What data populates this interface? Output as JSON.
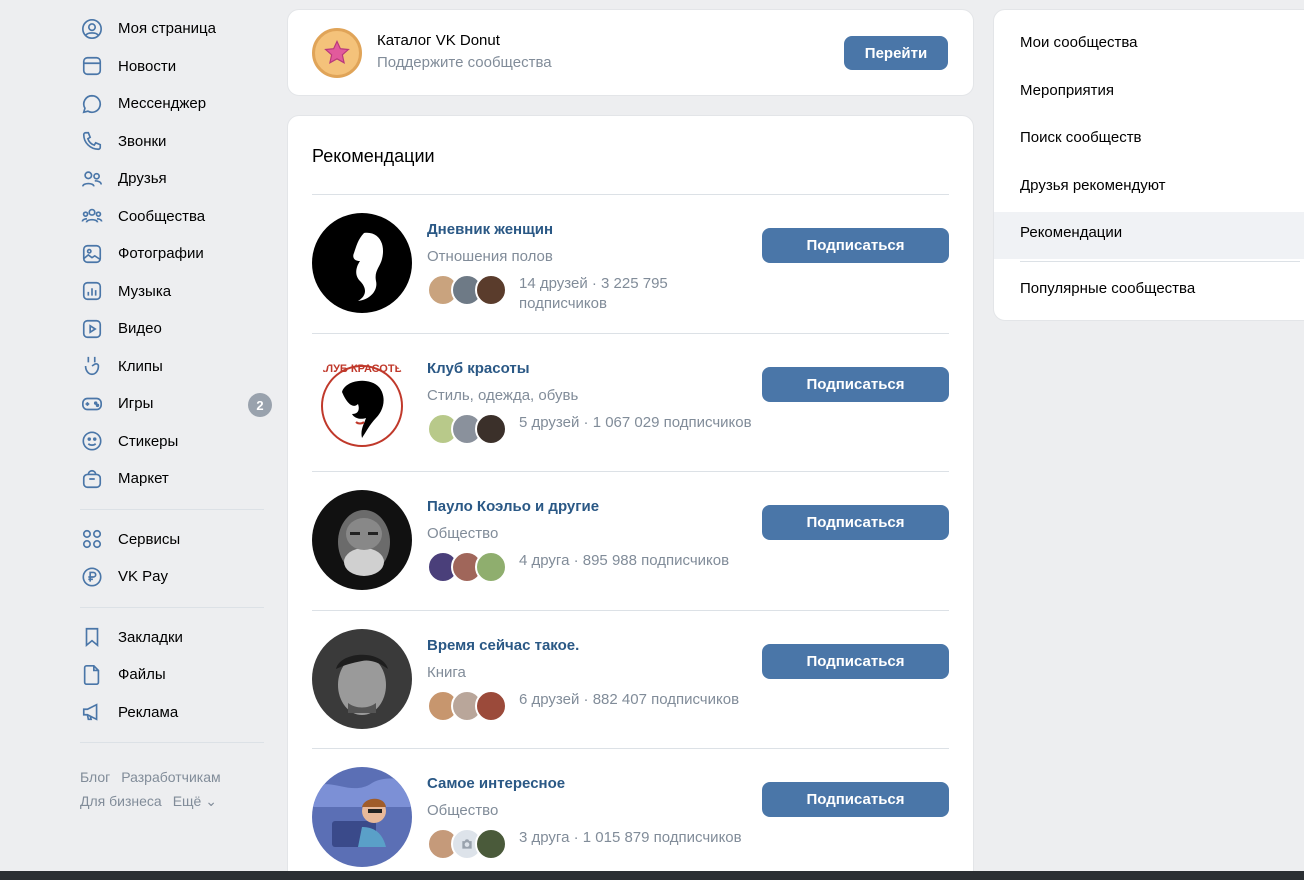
{
  "sidebar": {
    "items": [
      {
        "label": "Моя страница",
        "icon": "user-circle-icon"
      },
      {
        "label": "Новости",
        "icon": "news-icon"
      },
      {
        "label": "Мессенджер",
        "icon": "message-icon"
      },
      {
        "label": "Звонки",
        "icon": "phone-icon"
      },
      {
        "label": "Друзья",
        "icon": "friends-icon"
      },
      {
        "label": "Сообщества",
        "icon": "communities-icon"
      },
      {
        "label": "Фотографии",
        "icon": "photo-icon"
      },
      {
        "label": "Музыка",
        "icon": "music-icon"
      },
      {
        "label": "Видео",
        "icon": "video-icon"
      },
      {
        "label": "Клипы",
        "icon": "clips-icon"
      },
      {
        "label": "Игры",
        "icon": "games-icon",
        "badge": "2"
      },
      {
        "label": "Стикеры",
        "icon": "stickers-icon"
      },
      {
        "label": "Маркет",
        "icon": "market-icon"
      }
    ],
    "items2": [
      {
        "label": "Сервисы",
        "icon": "services-icon"
      },
      {
        "label": "VK Pay",
        "icon": "vkpay-icon"
      }
    ],
    "items3": [
      {
        "label": "Закладки",
        "icon": "bookmark-icon"
      },
      {
        "label": "Файлы",
        "icon": "file-icon"
      },
      {
        "label": "Реклама",
        "icon": "megaphone-icon"
      }
    ],
    "footer": [
      "Блог",
      "Разработчикам",
      "Для бизнеса",
      "Ещё ⌄"
    ]
  },
  "donut": {
    "title": "Каталог VK Donut",
    "subtitle": "Поддержите сообщества",
    "button": "Перейти"
  },
  "recs": {
    "title": "Рекомендации",
    "subscribe_label": "Подписаться",
    "items": [
      {
        "name": "Дневник женщин",
        "category": "Отношения полов",
        "stats": "14 друзей · 3 225 795 подписчиков"
      },
      {
        "name": "Клуб красоты",
        "category": "Стиль, одежда, обувь",
        "stats": "5 друзей · 1 067 029 подписчиков",
        "logo_text": "КЛУБ КРАСОТЫ"
      },
      {
        "name": "Пауло Коэльо и другие",
        "category": "Общество",
        "stats": "4 друга · 895 988 подписчиков"
      },
      {
        "name": "Время сейчас такое.",
        "category": "Книга",
        "stats": "6 друзей · 882 407 подписчиков"
      },
      {
        "name": "Самое интересное",
        "category": "Общество",
        "stats": "3 друга · 1 015 879 подписчиков"
      }
    ]
  },
  "rmenu": {
    "items": [
      {
        "label": "Мои сообщества"
      },
      {
        "label": "Мероприятия"
      },
      {
        "label": "Поиск сообществ"
      },
      {
        "label": "Друзья рекомендуют"
      },
      {
        "label": "Рекомендации",
        "active": true
      },
      {
        "label": "Популярные сообщества"
      }
    ]
  },
  "colors": {
    "accent": "#4a76a8",
    "link": "#2a5885",
    "muted": "#818c99",
    "icon": "#4a76a8"
  }
}
